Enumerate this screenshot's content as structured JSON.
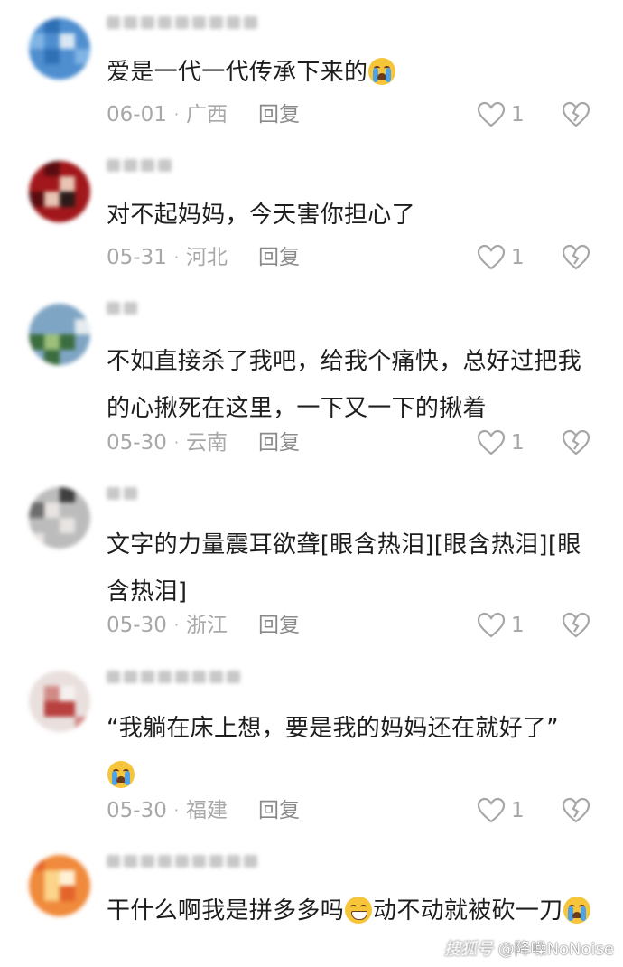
{
  "comments": [
    {
      "text_before": "爱是一代一代传承下来的",
      "emoji": "loudly-crying-face",
      "text_after": "",
      "date": "06-01",
      "location": "广西",
      "reply": "回复",
      "likes": "1",
      "avatar_colors": [
        "#4f8fd0",
        "#2f6fb5",
        "#7fb4e4",
        "#d9e7f3"
      ]
    },
    {
      "text_before": "对不起妈妈，今天害你担心了",
      "emoji": "",
      "text_after": "",
      "date": "05-31",
      "location": "河北",
      "reply": "回复",
      "likes": "1",
      "avatar_colors": [
        "#a1171b",
        "#5a0d10",
        "#e9c4b3",
        "#2a1a18"
      ]
    },
    {
      "text_before": "不如直接杀了我吧，给我个痛快，总好过把我的心揪死在这里，一下又一下的揪着",
      "emoji": "",
      "text_after": "",
      "date": "05-30",
      "location": "云南",
      "reply": "回复",
      "likes": "1",
      "avatar_colors": [
        "#7fa5c4",
        "#3b6d3e",
        "#9cc07a",
        "#e5ecef"
      ]
    },
    {
      "text_before": "文字的力量震耳欲聋[眼含热泪][眼含热泪][眼含热泪]",
      "emoji": "",
      "text_after": "",
      "date": "05-30",
      "location": "浙江",
      "reply": "回复",
      "likes": "1",
      "avatar_colors": [
        "#6d6d6d",
        "#bcbcbc",
        "#e8e4e2",
        "#3f3f3f"
      ]
    },
    {
      "text_before": "“我躺在床上想，要是我的妈妈还在就好了”",
      "emoji": "loudly-crying-face",
      "text_after": "",
      "date": "05-30",
      "location": "福建",
      "reply": "回复",
      "likes": "1",
      "avatar_colors": [
        "#e9e0de",
        "#b8403e",
        "#f5f1ef",
        "#d28a86"
      ]
    },
    {
      "text_before": "干什么啊我是拼多多吗",
      "emoji": "grinning-sweat-face",
      "text_after": "动不动就被砍一刀",
      "emoji2": "loudly-crying-face",
      "avatar_colors": [
        "#f08a3c",
        "#fbd48a",
        "#e3632a",
        "#fff1d6"
      ]
    }
  ],
  "watermark": {
    "logo": "搜狐号",
    "account": "@降噪NoNoise"
  },
  "icons": {
    "like": "heart-outline-icon",
    "dislike": "broken-heart-icon"
  },
  "colors": {
    "text": "#1d1d1d",
    "meta": "#a8a8a8",
    "icon": "#a6a6a6"
  }
}
